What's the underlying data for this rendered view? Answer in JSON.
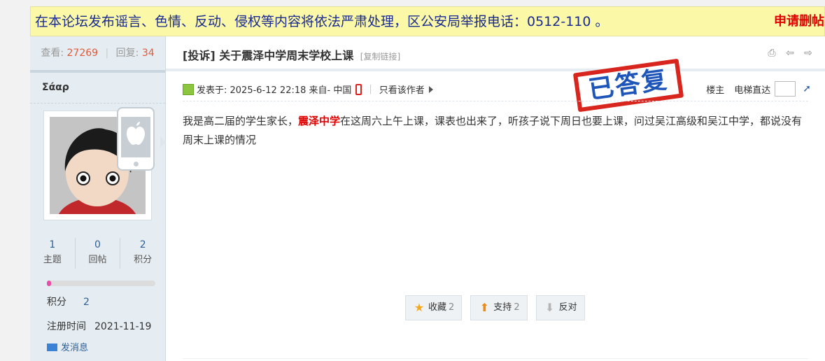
{
  "notice": {
    "text": "在本论坛发布谣言、色情、反动、侵权等内容将依法严肃处理，区公安局举报电话：0512-110 。",
    "report_link": "申请删帖"
  },
  "sidebar": {
    "views_label": "查看:",
    "views": "27269",
    "replies_label": "回复:",
    "replies": "34",
    "author": "Σάαρ",
    "counts": [
      {
        "value": "1",
        "label": "主题"
      },
      {
        "value": "0",
        "label": "回帖"
      },
      {
        "value": "2",
        "label": "积分"
      }
    ],
    "points_label": "积分",
    "points_value": "2",
    "reg_label": "注册时间",
    "reg_value": "2021-11-19",
    "msg_label": "发消息"
  },
  "post": {
    "title": "[投诉] 关于震泽中学周末学校上课",
    "copy_link": "[复制链接]",
    "posted_on": "发表于: 2025-6-12 22:18 来自- 中国",
    "only_author": "只看该作者",
    "louzhu": "楼主",
    "jump_label": "电梯直达",
    "stamp": "已答复",
    "content_before": "我是高二届的学生家长，",
    "content_highlight": "震泽中学",
    "content_after": "在这周六上午上课，课表也出来了，听孩子说下周日也要上课，问过吴江高级和吴江中学，都说没有周末上课的情况",
    "buttons": {
      "favorite_label": "收藏",
      "favorite_count": "2",
      "support_label": "支持",
      "support_count": "2",
      "oppose_label": "反对"
    }
  }
}
